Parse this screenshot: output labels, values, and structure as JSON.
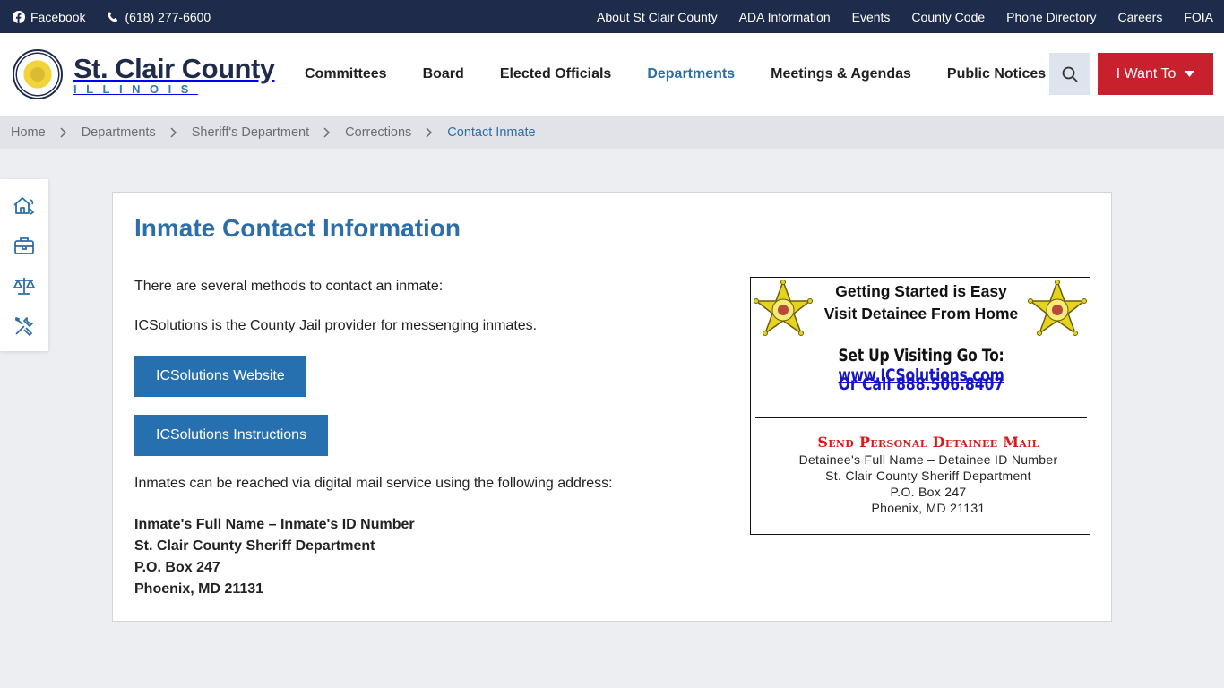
{
  "topbar": {
    "facebook": "Facebook",
    "phone": "(618) 277-6600",
    "links": [
      "About St Clair County",
      "ADA Information",
      "Events",
      "County Code",
      "Phone Directory",
      "Careers",
      "FOIA"
    ]
  },
  "logo": {
    "title": "St. Clair County",
    "subtitle": "ILLINOIS"
  },
  "nav": {
    "items": [
      "Committees",
      "Board",
      "Elected Officials",
      "Departments",
      "Meetings & Agendas",
      "Public Notices"
    ],
    "active": "Departments",
    "cta": "I Want To"
  },
  "breadcrumb": [
    "Home",
    "Departments",
    "Sheriff's Department",
    "Corrections",
    "Contact Inmate"
  ],
  "sidetools": [
    "housing-icon",
    "briefcase-icon",
    "scales-icon",
    "tools-icon"
  ],
  "content": {
    "title": "Inmate Contact Information",
    "intro": "There are several methods to contact an inmate:",
    "provider": "ICSolutions is the County Jail provider for messenging inmates.",
    "button_website": "ICSolutions Website",
    "button_instructions": "ICSolutions Instructions",
    "mail_intro": "Inmates can be reached via digital mail service using the following address:",
    "address": [
      "Inmate's Full Name – Inmate's ID Number",
      "St. Clair County Sheriff Department",
      "P.O. Box 247",
      "Phoenix, MD 21131"
    ]
  },
  "flyer": {
    "line1": "Getting Started is Easy",
    "line2": "Visit Detainee From Home",
    "setup_prefix": "Set Up Visiting Go To: ",
    "setup_link": "www.ICSolutions.com",
    "call": "Or Call 888.506.8407",
    "mail_heading": "Send Personal Detainee Mail",
    "mail_lines": [
      "Detainee's Full Name – Detainee ID Number",
      "St. Clair County Sheriff Department",
      "P.O. Box 247",
      "Phoenix, MD 21131"
    ]
  },
  "colors": {
    "topbar": "#1f2b4a",
    "accent_blue": "#2d6ea8",
    "button_blue": "#2670b0",
    "cta_red": "#c9202d"
  }
}
